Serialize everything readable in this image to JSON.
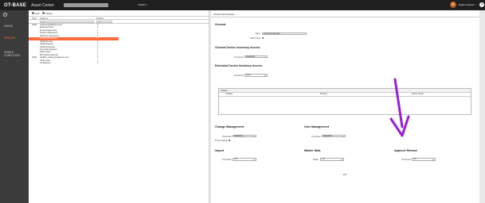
{
  "app": {
    "logo": "OT-BASE",
    "name": "Asset Center",
    "menu_label": "USERS ⌄",
    "user_name": "Ralph Langner ⌄",
    "help": "?"
  },
  "sidebar": {
    "items": [
      {
        "label": "USERS"
      },
      {
        "label": "GROUPS"
      },
      {
        "label": "MOBILE COMPUTERS"
      }
    ]
  },
  "groups": {
    "add_label": "Add",
    "delete_label": "Delete",
    "col_type": "Type",
    "col_group": "Group ▲",
    "col_users": "# Users",
    "filter_placeholder": "Filter",
    "rows": [
      {
        "type": "LDAP",
        "name": "engineering@langner.com",
        "users": "5"
      },
      {
        "type": "",
        "name": "Europe Ent user",
        "users": "2"
      },
      {
        "type": "",
        "name": "Europe Engineering",
        "users": "1"
      },
      {
        "type": "",
        "name": "Finland maintenance",
        "users": "1"
      },
      {
        "type": "",
        "name": "Flat Rock maintenance",
        "users": "2"
      },
      {
        "type": "",
        "name": "Global Administrator",
        "users": "4"
      },
      {
        "type": "",
        "name": "Global Ent user",
        "users": "2"
      },
      {
        "type": "",
        "name": "Global Engineer",
        "users": "2"
      },
      {
        "type": "",
        "name": "Global Supervisor",
        "users": "6"
      },
      {
        "type": "",
        "name": "Green Bay Engineer",
        "users": "1"
      },
      {
        "type": "",
        "name": "Maintenance",
        "users": "1"
      },
      {
        "type": "",
        "name": "PKIT global read-only",
        "users": "1"
      },
      {
        "type": "LDAP",
        "name": "satellite_maintenance@acme.com",
        "users": "0"
      },
      {
        "type": "",
        "name": "US Ent user",
        "users": "1"
      },
      {
        "type": "",
        "name": "US Engineer",
        "users": "1"
      }
    ]
  },
  "detail": {
    "title": "Global Administrator",
    "general": {
      "heading": "General",
      "name_label": "Name",
      "name_value": "Global Administrator",
      "ldap_label": "LDAP Group"
    },
    "gdia": {
      "heading": "General Device Inventory Access",
      "perm_label": "Permission",
      "perm_value": "Read/Write"
    },
    "edia": {
      "heading": "Extended Device Inventory Access",
      "perm_label": "Permission",
      "perm_value": "None"
    },
    "scopes": {
      "heading": "Scopes",
      "col_location": "Location",
      "col_process": "Process",
      "col_device_group": "Device Group"
    },
    "change_mgmt": {
      "heading": "Change Management",
      "perm_label": "Permission",
      "perm_value": "Read/Write",
      "permit_label": "Permit Change"
    },
    "user_mgmt": {
      "heading": "User Management",
      "perm_label": "Permission",
      "perm_value": "Read/Write"
    },
    "import": {
      "heading": "Import",
      "perm_label": "Permission",
      "perm_value": "Yes"
    },
    "master_data": {
      "heading": "Master Data",
      "modify_label": "Modify",
      "modify_value": "Yes"
    },
    "approve_release": {
      "heading": "Approve Release",
      "perm_label": "Permission",
      "perm_value": "Yes"
    },
    "exit_label": "Exit"
  },
  "colors": {
    "accent": "#ff6a3c",
    "topbar": "#1f1f1f",
    "sidebar": "#3b3b3b",
    "annotation_arrow": "#9b1fd6"
  }
}
